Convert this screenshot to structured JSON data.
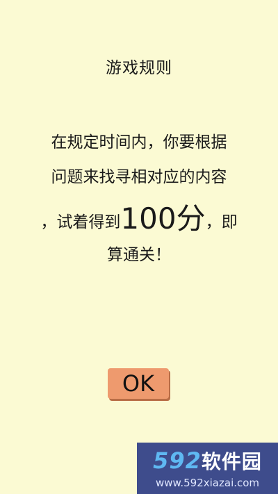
{
  "dialog": {
    "title": "游戏规则",
    "rules_lines": [
      "在规定时间内，你要根据",
      "问题来找寻相对应的内容"
    ],
    "line3_before": "，试着得到",
    "line3_score": "100分",
    "line3_after": "，即",
    "line4": "算通关！",
    "ok_label": "OK"
  },
  "colors": {
    "background": "#FBFAD3",
    "ok_button": "#EE9A6E",
    "watermark_bg": "#3E4C8C",
    "watermark_accent": "#5FB8F2"
  },
  "watermark": {
    "logo_number": "592",
    "logo_text": "软件园",
    "url": "www.592xiazai.com"
  }
}
